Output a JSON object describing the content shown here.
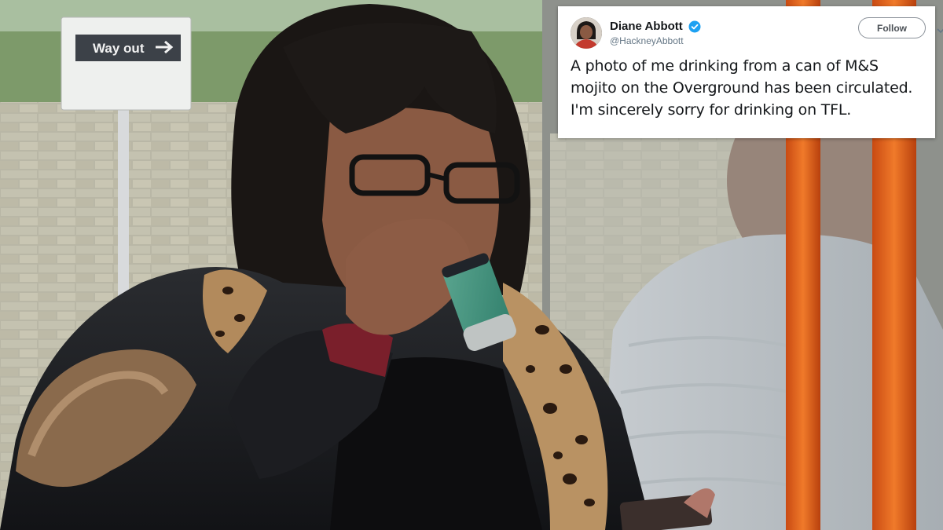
{
  "photo": {
    "sign_text": "Way out"
  },
  "tweet": {
    "display_name": "Diane Abbott",
    "handle": "@HackneyAbbott",
    "follow_label": "Follow",
    "text": "A photo of me drinking from a can of M&S mojito on the Overground has been circulated. I'm sincerely sorry for drinking on TFL."
  }
}
